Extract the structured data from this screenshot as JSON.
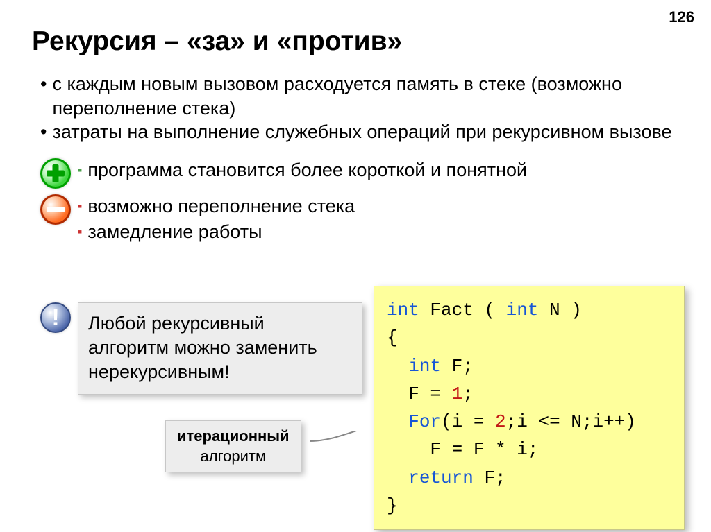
{
  "page_number": "126",
  "title": "Рекурсия – «за» и «против»",
  "top_bullets": [
    "с каждым новым вызовом расходуется память в стеке (возможно переполнение стека)",
    "затраты на выполнение служебных операций при рекурсивном вызове"
  ],
  "pros": [
    "программа становится более короткой и понятной"
  ],
  "cons": [
    "возможно переполнение стека",
    "замедление работы"
  ],
  "note_text": "Любой рекурсивный алгоритм можно заменить нерекурсивным!",
  "label_bold": "итерационный",
  "label_rest": "алгоритм",
  "code": {
    "l1_kw1": "int",
    "l1_name": " Fact ( ",
    "l1_kw2": "int",
    "l1_rest": " N )",
    "l2": "{",
    "l3_indent": "  ",
    "l3_kw": "int",
    "l3_rest": " F;",
    "l4_indent": "  ",
    "l4_a": "F = ",
    "l4_num": "1",
    "l4_b": ";",
    "l5_indent": "  ",
    "l5_kw": "For",
    "l5_a": "(i = ",
    "l5_num": "2",
    "l5_b": ";i <= N;i++)",
    "l6_indent": "    ",
    "l6": "F = F * i;",
    "l7_indent": "  ",
    "l7_kw": "return",
    "l7_rest": " F;",
    "l8": "}"
  }
}
